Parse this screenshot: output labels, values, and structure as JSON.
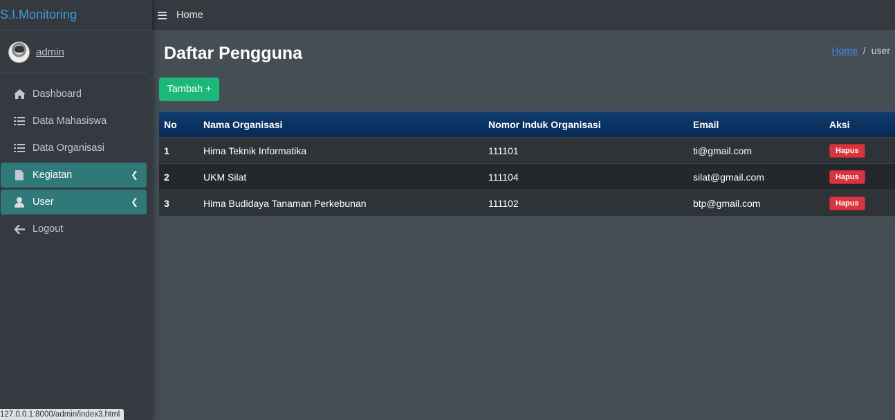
{
  "brand": "S.I.Monitoring",
  "user": {
    "name": "admin"
  },
  "sidebar": {
    "items": [
      {
        "label": "Dashboard",
        "icon": "home-icon"
      },
      {
        "label": "Data Mahasiswa",
        "icon": "list-icon"
      },
      {
        "label": "Data Organisasi",
        "icon": "list-icon"
      },
      {
        "label": "Kegiatan",
        "icon": "file-icon",
        "active": true
      },
      {
        "label": "User",
        "icon": "user-icon",
        "active": true
      },
      {
        "label": "Logout",
        "icon": "arrow-left-icon"
      }
    ]
  },
  "topbar": {
    "home_label": "Home"
  },
  "page": {
    "title": "Daftar Pengguna",
    "breadcrumb": {
      "home": "Home",
      "current": "user"
    },
    "add_button": "Tambah +"
  },
  "table": {
    "headers": [
      "No",
      "Nama Organisasi",
      "Nomor Induk Organisasi",
      "Email",
      "Aksi"
    ],
    "rows": [
      {
        "no": "1",
        "nama": "Hima Teknik Informatika",
        "nomor": "111101",
        "email": "ti@gmail.com",
        "aksi": "Hapus"
      },
      {
        "no": "2",
        "nama": "UKM Silat",
        "nomor": "111104",
        "email": "silat@gmail.com",
        "aksi": "Hapus"
      },
      {
        "no": "3",
        "nama": "Hima Budidaya Tanaman Perkebunan",
        "nomor": "111102",
        "email": "btp@gmail.com",
        "aksi": "Hapus"
      }
    ]
  },
  "status_bar": {
    "url": "127.0.0.1:8000/admin/index3.html"
  },
  "colors": {
    "accent_active": "#2f7a78",
    "add_button": "#1ab97a",
    "delete_button": "#d9353f",
    "table_header": "#0f3c6e",
    "brand_text": "#3f9bd9"
  }
}
